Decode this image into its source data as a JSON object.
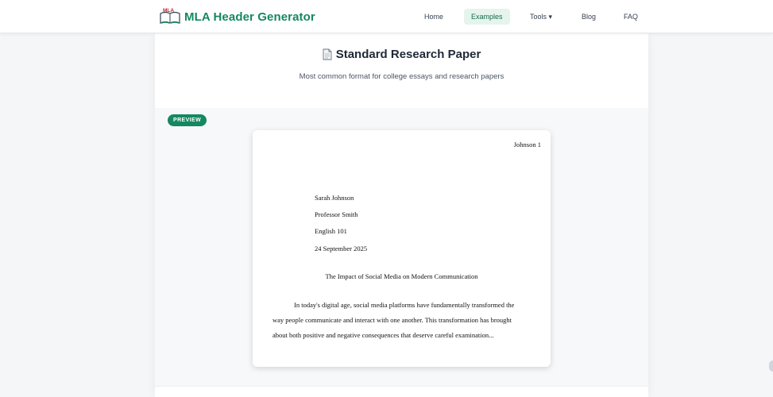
{
  "nav": {
    "brand_badge": "MLA",
    "brand": "MLA Header Generator",
    "items": [
      {
        "label": "Home"
      },
      {
        "label": "Examples"
      },
      {
        "label": "Tools ▾"
      },
      {
        "label": "Blog"
      },
      {
        "label": "FAQ"
      }
    ]
  },
  "hero": {
    "title": "Standard Research Paper",
    "subtitle": "Most common format for college essays and research papers"
  },
  "preview": {
    "badge": "PREVIEW",
    "running_head": "Johnson 1",
    "header_lines": [
      "Sarah Johnson",
      "Professor Smith",
      "English 101",
      "24 September 2025"
    ],
    "title": "The Impact of Social Media on Modern Communication",
    "body": "In today's digital age, social media platforms have fundamentally transformed the way people communicate and interact with one another. This transformation has brought about both positive and negative consequences that deserve careful examination..."
  },
  "colors": {
    "brand": "#15885f",
    "active_nav_bg": "#e6f4ee"
  }
}
